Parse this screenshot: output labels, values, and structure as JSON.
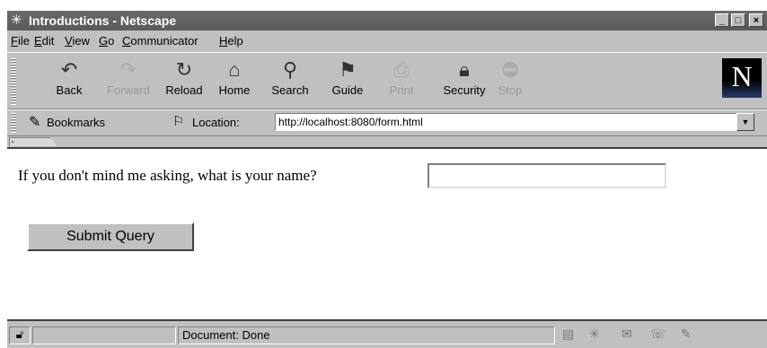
{
  "window": {
    "title": "Introductions - Netscape",
    "app_icon": "netscape-window-icon"
  },
  "window_controls": {
    "minimize": "_",
    "maximize": "□",
    "close": "×"
  },
  "menu": [
    {
      "label": "File",
      "mnemonic": "F"
    },
    {
      "label": "Edit",
      "mnemonic": "E"
    },
    {
      "label": "View",
      "mnemonic": "V"
    },
    {
      "label": "Go",
      "mnemonic": "G"
    },
    {
      "label": "Communicator",
      "mnemonic": "C"
    },
    {
      "label": "Help",
      "mnemonic": "H"
    }
  ],
  "toolbar": {
    "buttons": [
      {
        "label": "Back",
        "icon": "back-arrow-icon",
        "enabled": true
      },
      {
        "label": "Forward",
        "icon": "forward-arrow-icon",
        "enabled": false
      },
      {
        "label": "Reload",
        "icon": "reload-icon",
        "enabled": true
      },
      {
        "label": "Home",
        "icon": "home-icon",
        "enabled": true
      },
      {
        "label": "Search",
        "icon": "search-icon",
        "enabled": true
      },
      {
        "label": "Guide",
        "icon": "guide-icon",
        "enabled": true
      },
      {
        "label": "Print",
        "icon": "print-icon",
        "enabled": false
      },
      {
        "label": "Security",
        "icon": "lock-icon",
        "enabled": true
      },
      {
        "label": "Stop",
        "icon": "stop-icon",
        "enabled": false
      }
    ],
    "logo_letter": "N"
  },
  "location_bar": {
    "bookmarks_label": "Bookmarks",
    "location_label": "Location:",
    "url": "http://localhost:8080/form.html"
  },
  "page": {
    "question": "If you don't mind me asking, what is your name?",
    "name_value": "",
    "submit_label": "Submit Query"
  },
  "status_bar": {
    "text": "Document: Done"
  },
  "colors": {
    "titlebar": "#5f5f5f",
    "chrome": "#c0c0c0",
    "page_bg": "#ffffff"
  }
}
